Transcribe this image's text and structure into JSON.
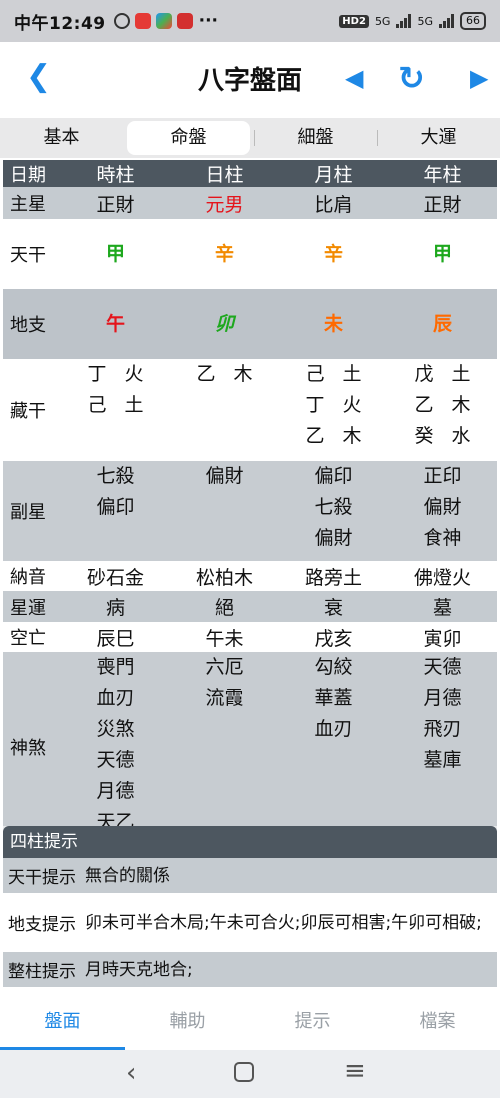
{
  "status_bar": {
    "time": "中午12:49",
    "more": "···",
    "hd": "HD2",
    "net1": "5G",
    "net2": "5G",
    "battery": "66"
  },
  "header": {
    "title": "八字盤面"
  },
  "tabs": [
    {
      "label": "基本",
      "active": false
    },
    {
      "label": "命盤",
      "active": true
    },
    {
      "label": "細盤",
      "active": false
    },
    {
      "label": "大運",
      "active": false
    }
  ],
  "chart": {
    "header": [
      "日期",
      "時柱",
      "日柱",
      "月柱",
      "年柱"
    ],
    "main_star": {
      "label": "主星",
      "values": [
        "正財",
        "元男",
        "比肩",
        "正財"
      ]
    },
    "tiangan": {
      "label": "天干",
      "values": [
        "甲",
        "辛",
        "辛",
        "甲"
      ]
    },
    "dizhi": {
      "label": "地支",
      "values": [
        "午",
        "卯",
        "未",
        "辰"
      ]
    },
    "canggan": {
      "label": "藏干",
      "values": [
        [
          "丁 火",
          "己 土"
        ],
        [
          "乙 木"
        ],
        [
          "己 土",
          "丁 火",
          "乙 木"
        ],
        [
          "戊 土",
          "乙 木",
          "癸 水"
        ]
      ]
    },
    "fuxing": {
      "label": "副星",
      "values": [
        [
          "七殺",
          "偏印"
        ],
        [
          "偏財"
        ],
        [
          "偏印",
          "七殺",
          "偏財"
        ],
        [
          "正印",
          "偏財",
          "食神"
        ]
      ]
    },
    "nayin": {
      "label": "納音",
      "values": [
        "砂石金",
        "松柏木",
        "路旁土",
        "佛燈火"
      ]
    },
    "xingyun": {
      "label": "星運",
      "values": [
        "病",
        "絕",
        "衰",
        "墓"
      ]
    },
    "kongwang": {
      "label": "空亡",
      "values": [
        "辰巳",
        "午未",
        "戌亥",
        "寅卯"
      ]
    },
    "shensha": {
      "label": "神煞",
      "values": [
        [
          "喪門",
          "血刃",
          "災煞",
          "天德",
          "月德",
          "天乙"
        ],
        [
          "六厄",
          "流霞"
        ],
        [
          "勾絞",
          "華蓋",
          "血刃"
        ],
        [
          "天德",
          "月德",
          "飛刃",
          "墓庫"
        ]
      ]
    }
  },
  "colors": {
    "wood": "#1ea81e",
    "metal": "#f28a00",
    "fire": "#e5141b",
    "earth": "#ff6a00",
    "accent": "#1e88e5",
    "day_master": "#e5141b"
  },
  "hints": {
    "title": "四柱提示",
    "rows": [
      {
        "label": "天干提示",
        "value": "無合的關係"
      },
      {
        "label": "地支提示",
        "value": "卯未可半合木局;午未可合火;卯辰可相害;午卯可相破;"
      },
      {
        "label": "整柱提示",
        "value": "月時天克地合;"
      }
    ]
  },
  "bottom_nav": [
    {
      "label": "盤面",
      "active": true
    },
    {
      "label": "輔助",
      "active": false
    },
    {
      "label": "提示",
      "active": false
    },
    {
      "label": "檔案",
      "active": false
    }
  ]
}
